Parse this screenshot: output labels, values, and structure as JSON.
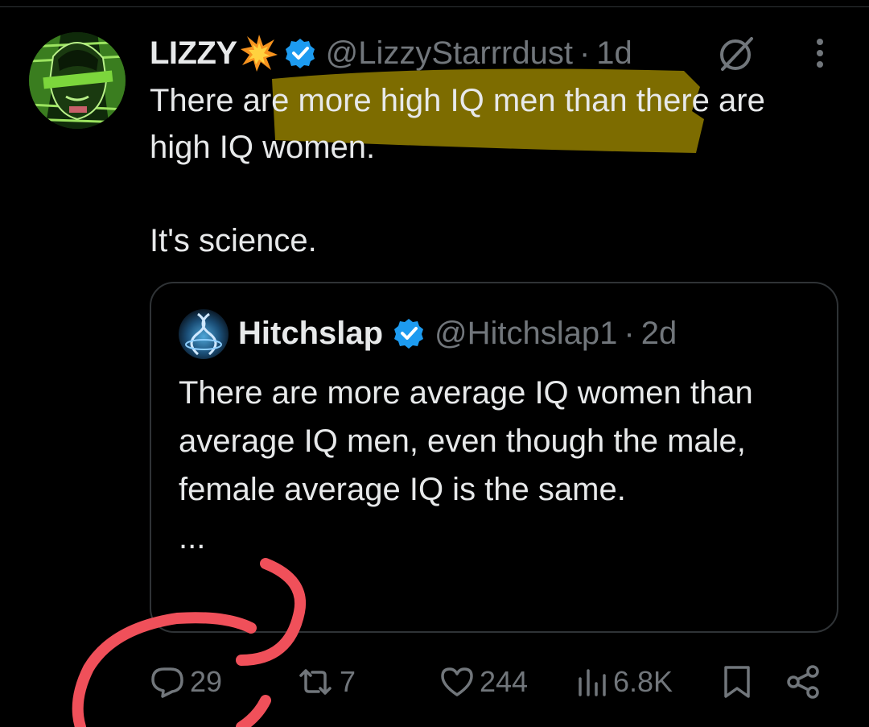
{
  "tweet": {
    "display_name": "LIZZY",
    "handle": "@LizzyStarrrdust",
    "separator": "·",
    "time": "1d",
    "text_line1": "There are more high IQ men than there are high IQ women.",
    "text_line2": "It's science."
  },
  "quote": {
    "display_name": "Hitchslap",
    "handle": "@Hitchslap1",
    "separator": "·",
    "time": "2d",
    "text": "There are more average IQ women than average IQ men, even though the male, female average IQ is the same.",
    "ellipsis": "..."
  },
  "actions": {
    "replies": "29",
    "reposts": "7",
    "likes": "244",
    "views": "6.8K"
  },
  "icons": {
    "emoji": "collision-emoji",
    "verified": "verified-badge-icon",
    "grok": "grok-icon",
    "more": "more-options-icon",
    "reply": "reply-icon",
    "repost": "repost-icon",
    "like": "like-icon",
    "views": "views-icon",
    "bookmark": "bookmark-icon",
    "share": "share-icon"
  },
  "colors": {
    "background": "#000000",
    "text": "#e7e9ea",
    "muted": "#71767b",
    "verified": "#1d9bf0",
    "highlight": "#a08a00",
    "annotation": "#f0505a"
  }
}
